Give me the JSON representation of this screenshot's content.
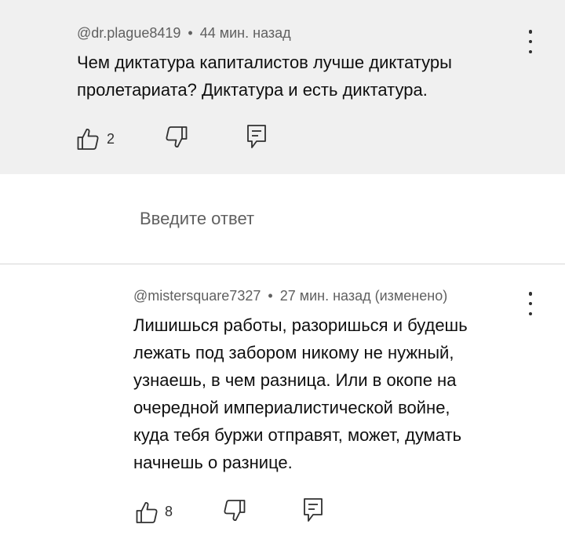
{
  "comment": {
    "author": "@dr.plague8419",
    "separator": "•",
    "time": "44 мин. назад",
    "text_lines": [
      "Чем диктатура капиталистов лучше диктатуры",
      "пролетариата? Диктатура и есть диктатура."
    ],
    "like_count": "2",
    "icons": {
      "like": "thumbs-up-icon",
      "dislike": "thumbs-down-icon",
      "reply": "reply-icon",
      "menu": "more-vert-icon"
    }
  },
  "reply_box": {
    "placeholder": "Введите ответ"
  },
  "reply": {
    "author": "@mistersquare7327",
    "separator": "•",
    "time": "27 мин. назад (изменено)",
    "text_lines": [
      "Лишишься работы, разоришься и будешь",
      "лежать под забором никому не нужный,",
      "узнаешь, в чем разница. Или в окопе на",
      "очередной империалистической войне,",
      "куда тебя буржи отправят, может, думать",
      "начнешь о разнице."
    ],
    "like_count": "8",
    "icons": {
      "like": "thumbs-up-icon",
      "dislike": "thumbs-down-icon",
      "reply": "reply-icon",
      "menu": "more-vert-icon"
    }
  },
  "colors": {
    "highlight_bg": "#f0f0f0",
    "meta_text": "#606060",
    "body_text": "#0f0f0f",
    "icon": "#303030"
  }
}
